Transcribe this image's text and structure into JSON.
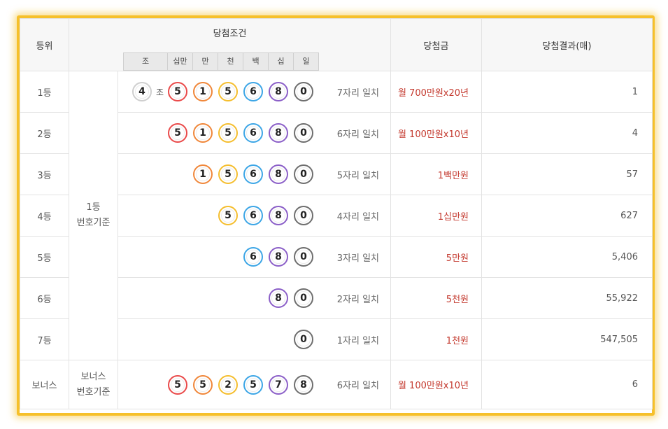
{
  "header": {
    "rank": "등위",
    "condition": "당첨조건",
    "digits": [
      "조",
      "십만",
      "만",
      "천",
      "백",
      "십",
      "일"
    ],
    "prize": "당첨금",
    "result": "당첨결과(매)"
  },
  "basis": {
    "first": [
      "1등",
      "번호기준"
    ],
    "bonus": [
      "보너스",
      "번호기준"
    ]
  },
  "jo_label": "조",
  "colors": {
    "frame": "#f6c02a",
    "prize_text": "#c43a2f",
    "ball_red": "#ea4a4a",
    "ball_orange": "#f0873a",
    "ball_yellow": "#f5be2e",
    "ball_blue": "#3da6e6",
    "ball_purple": "#8b5fc8",
    "ball_dark": "#6e6e6e"
  },
  "rows": [
    {
      "rank": "1등",
      "group": "4",
      "balls": [
        "5",
        "1",
        "5",
        "6",
        "8",
        "0"
      ],
      "match": "7자리 일치",
      "prize": "월 700만원x20년",
      "count": "1"
    },
    {
      "rank": "2등",
      "balls": [
        "5",
        "1",
        "5",
        "6",
        "8",
        "0"
      ],
      "match": "6자리 일치",
      "prize": "월 100만원x10년",
      "count": "4"
    },
    {
      "rank": "3등",
      "balls": [
        "1",
        "5",
        "6",
        "8",
        "0"
      ],
      "match": "5자리 일치",
      "prize": "1백만원",
      "count": "57"
    },
    {
      "rank": "4등",
      "balls": [
        "5",
        "6",
        "8",
        "0"
      ],
      "match": "4자리 일치",
      "prize": "1십만원",
      "count": "627"
    },
    {
      "rank": "5등",
      "balls": [
        "6",
        "8",
        "0"
      ],
      "match": "3자리 일치",
      "prize": "5만원",
      "count": "5,406"
    },
    {
      "rank": "6등",
      "balls": [
        "8",
        "0"
      ],
      "match": "2자리 일치",
      "prize": "5천원",
      "count": "55,922"
    },
    {
      "rank": "7등",
      "balls": [
        "0"
      ],
      "match": "1자리 일치",
      "prize": "1천원",
      "count": "547,505"
    },
    {
      "rank": "보너스",
      "balls": [
        "5",
        "5",
        "2",
        "5",
        "7",
        "8"
      ],
      "match": "6자리 일치",
      "prize": "월 100만원x10년",
      "count": "6"
    }
  ]
}
